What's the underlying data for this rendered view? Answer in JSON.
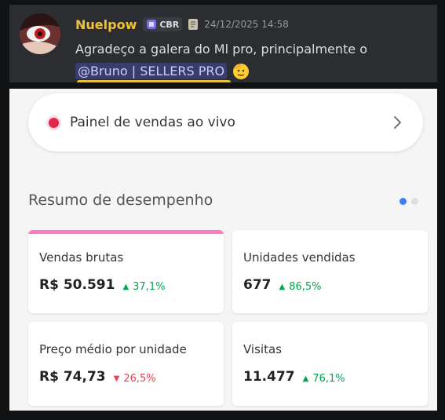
{
  "message": {
    "author": "Nuelpow",
    "tag": "CBR",
    "timestamp": "24/12/2025 14:58",
    "line1": "Agradeço a galera do Ml pro, principalmente o",
    "mention": "@Bruno | SELLERS PRO",
    "colors": {
      "author": "#f0c23a",
      "mention_bg": "#3c4270"
    }
  },
  "app": {
    "live_panel": {
      "label": "Painel de vendas ao vivo",
      "dot_color": "#e0294d"
    },
    "section_title": "Resumo de desempenho",
    "pagination": {
      "pages": 2,
      "active": 1
    },
    "metrics": [
      {
        "label": "Vendas brutas",
        "value": "R$ 50.591",
        "change": "37,1%",
        "direction": "up"
      },
      {
        "label": "Unidades vendidas",
        "value": "677",
        "change": "86,5%",
        "direction": "up"
      },
      {
        "label": "Preço médio por unidade",
        "value": "R$ 74,73",
        "change": "26,5%",
        "direction": "down"
      },
      {
        "label": "Visitas",
        "value": "11.477",
        "change": "76,1%",
        "direction": "up"
      }
    ],
    "colors": {
      "up": "#00a650",
      "down": "#f23d4f",
      "accent": "#ff7ac3",
      "active_dot": "#3483fa"
    }
  }
}
